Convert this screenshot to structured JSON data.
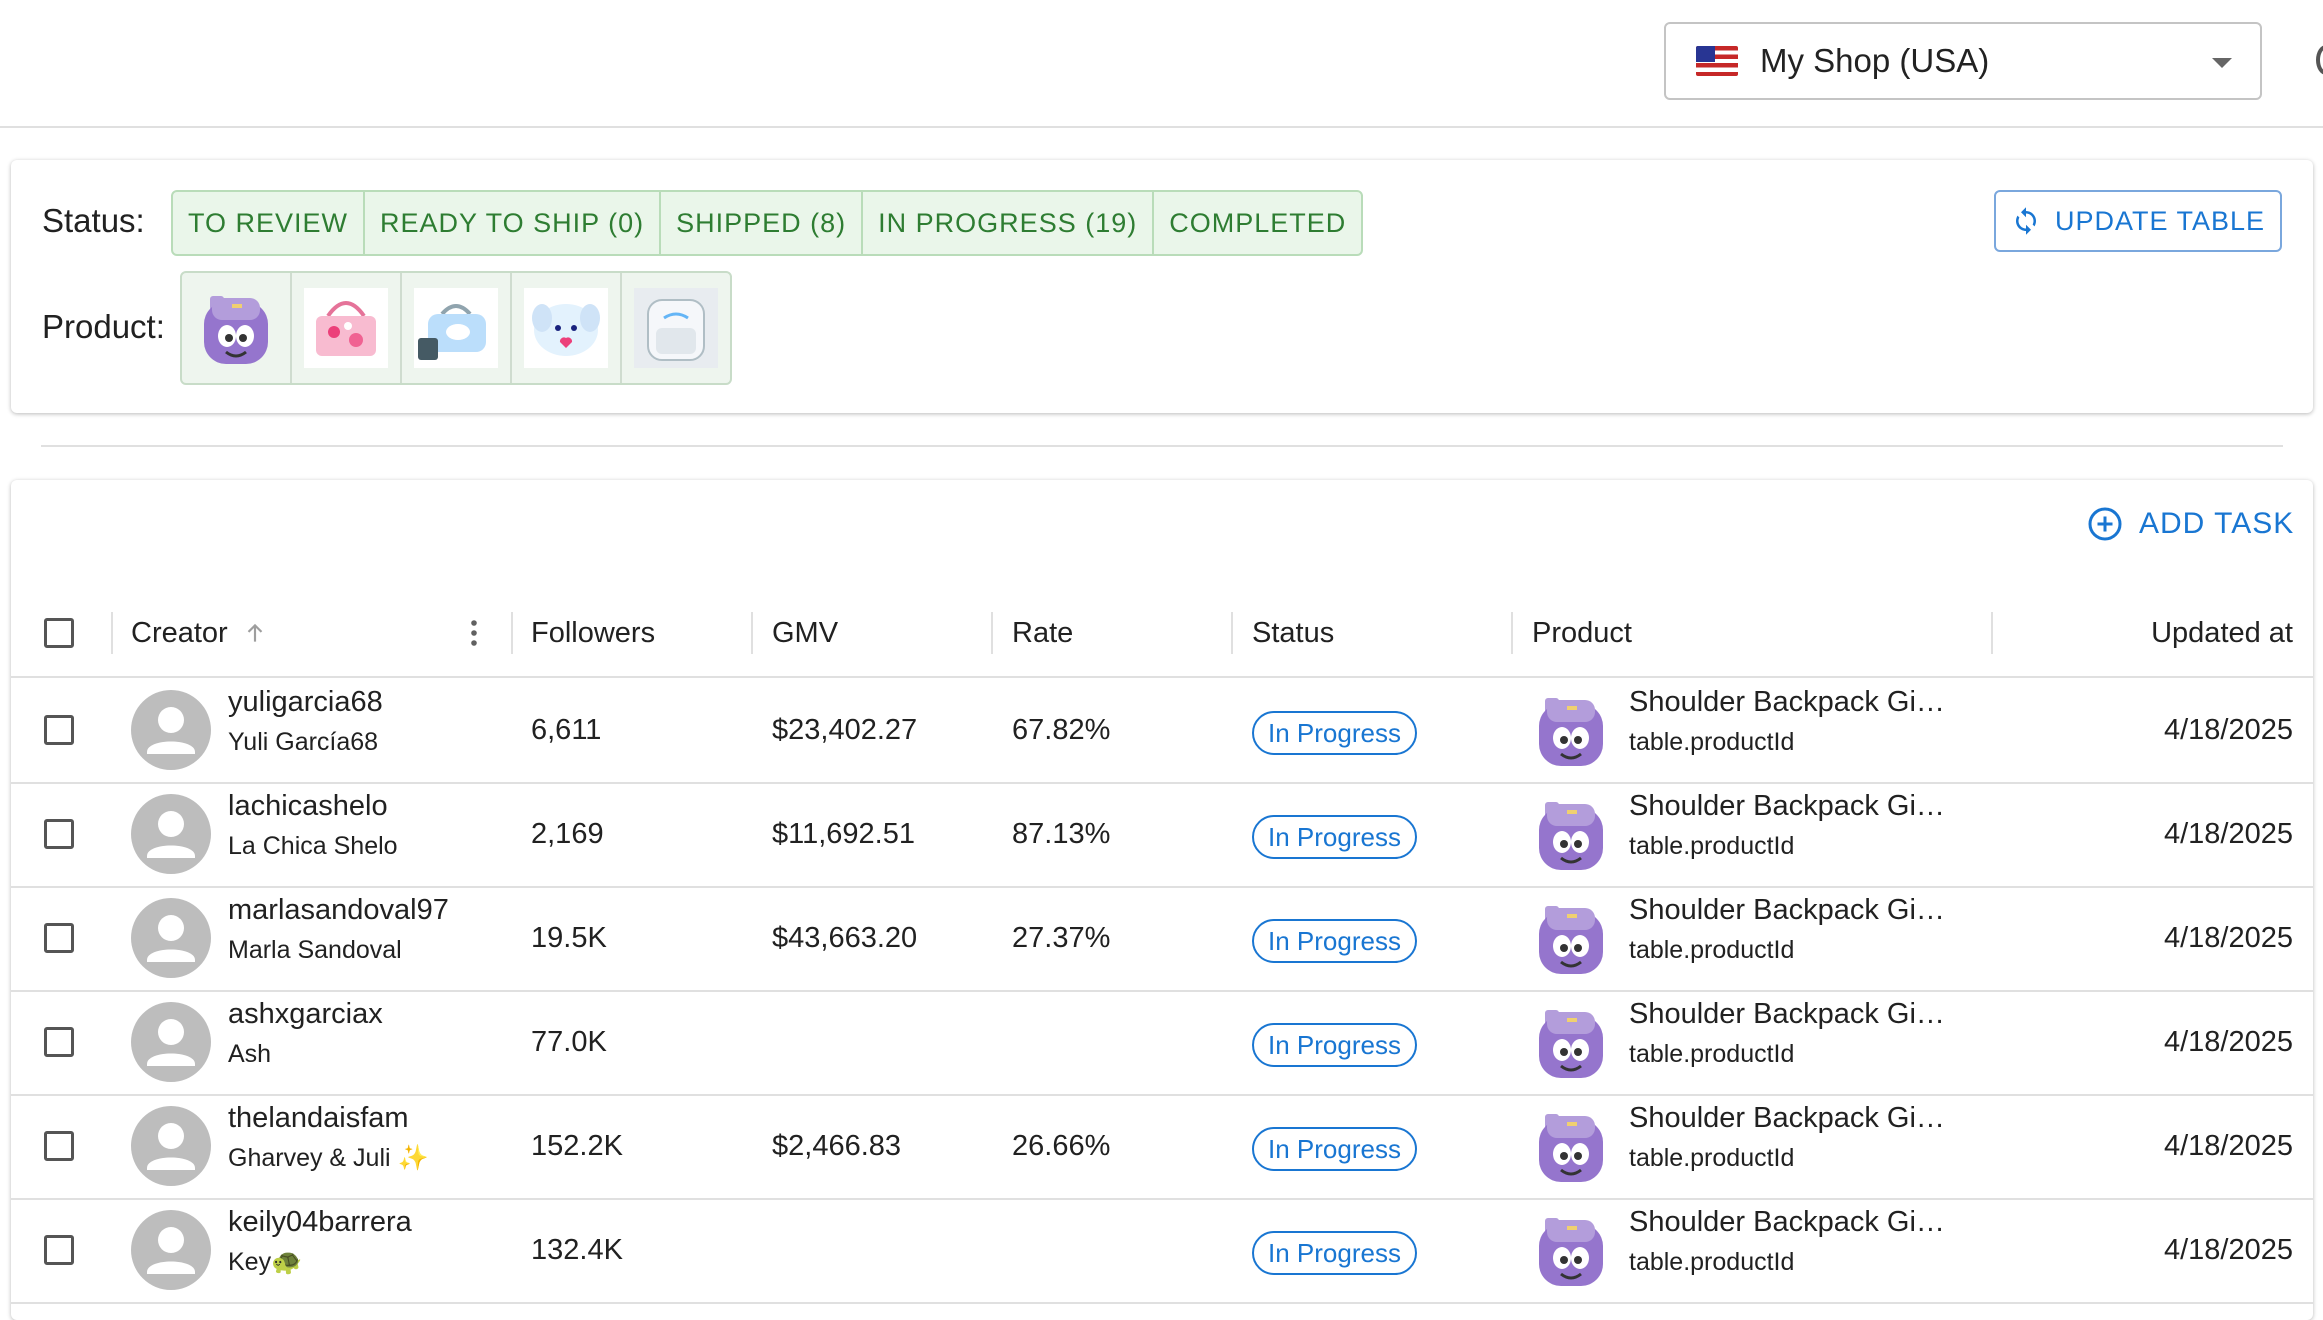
{
  "topbar": {
    "shop_select": {
      "label": "My Shop (USA)",
      "flag_icon": "us-flag-icon"
    }
  },
  "filters": {
    "status_label": "Status:",
    "statuses": [
      {
        "label": "TO REVIEW"
      },
      {
        "label": "READY TO SHIP (0)"
      },
      {
        "label": "SHIPPED (8)"
      },
      {
        "label": "IN PROGRESS (19)"
      },
      {
        "label": "COMPLETED"
      }
    ],
    "product_label": "Product:",
    "products": [
      "purple-backpack",
      "pink-handbag",
      "blue-bag",
      "plush-bag",
      "white-backpack"
    ],
    "update_button": "UPDATE TABLE"
  },
  "table": {
    "add_task": "ADD TASK",
    "columns": {
      "creator": "Creator",
      "followers": "Followers",
      "gmv": "GMV",
      "rate": "Rate",
      "status": "Status",
      "product": "Product",
      "updated": "Updated at"
    },
    "rows": [
      {
        "username": "yuligarcia68",
        "display_name": "Yuli García68",
        "followers": "6,611",
        "gmv": "$23,402.27",
        "rate": "67.82%",
        "status": "In Progress",
        "product_name": "Shoulder Backpack Gi…",
        "product_id": "table.productId",
        "updated": "4/18/2025"
      },
      {
        "username": "lachicashelo",
        "display_name": "La Chica Shelo",
        "followers": "2,169",
        "gmv": "$11,692.51",
        "rate": "87.13%",
        "status": "In Progress",
        "product_name": "Shoulder Backpack Gi…",
        "product_id": "table.productId",
        "updated": "4/18/2025"
      },
      {
        "username": "marlasandoval97",
        "display_name": "Marla Sandoval",
        "followers": "19.5K",
        "gmv": "$43,663.20",
        "rate": "27.37%",
        "status": "In Progress",
        "product_name": "Shoulder Backpack Gi…",
        "product_id": "table.productId",
        "updated": "4/18/2025"
      },
      {
        "username": "ashxgarciax",
        "display_name": "Ash",
        "followers": "77.0K",
        "gmv": "",
        "rate": "",
        "status": "In Progress",
        "product_name": "Shoulder Backpack Gi…",
        "product_id": "table.productId",
        "updated": "4/18/2025"
      },
      {
        "username": "thelandaisfam",
        "display_name": "Gharvey & Juli ✨",
        "followers": "152.2K",
        "gmv": "$2,466.83",
        "rate": "26.66%",
        "status": "In Progress",
        "product_name": "Shoulder Backpack Gi…",
        "product_id": "table.productId",
        "updated": "4/18/2025"
      },
      {
        "username": "keily04barrera",
        "display_name": "Key🐢",
        "followers": "132.4K",
        "gmv": "",
        "rate": "",
        "status": "In Progress",
        "product_name": "Shoulder Backpack Gi…",
        "product_id": "table.productId",
        "updated": "4/18/2025"
      }
    ]
  },
  "colors": {
    "accent": "#1976d2",
    "status_green": "#2e7d32",
    "status_bg": "#eaf6ea",
    "avatar_grey": "#bdbdbd"
  }
}
